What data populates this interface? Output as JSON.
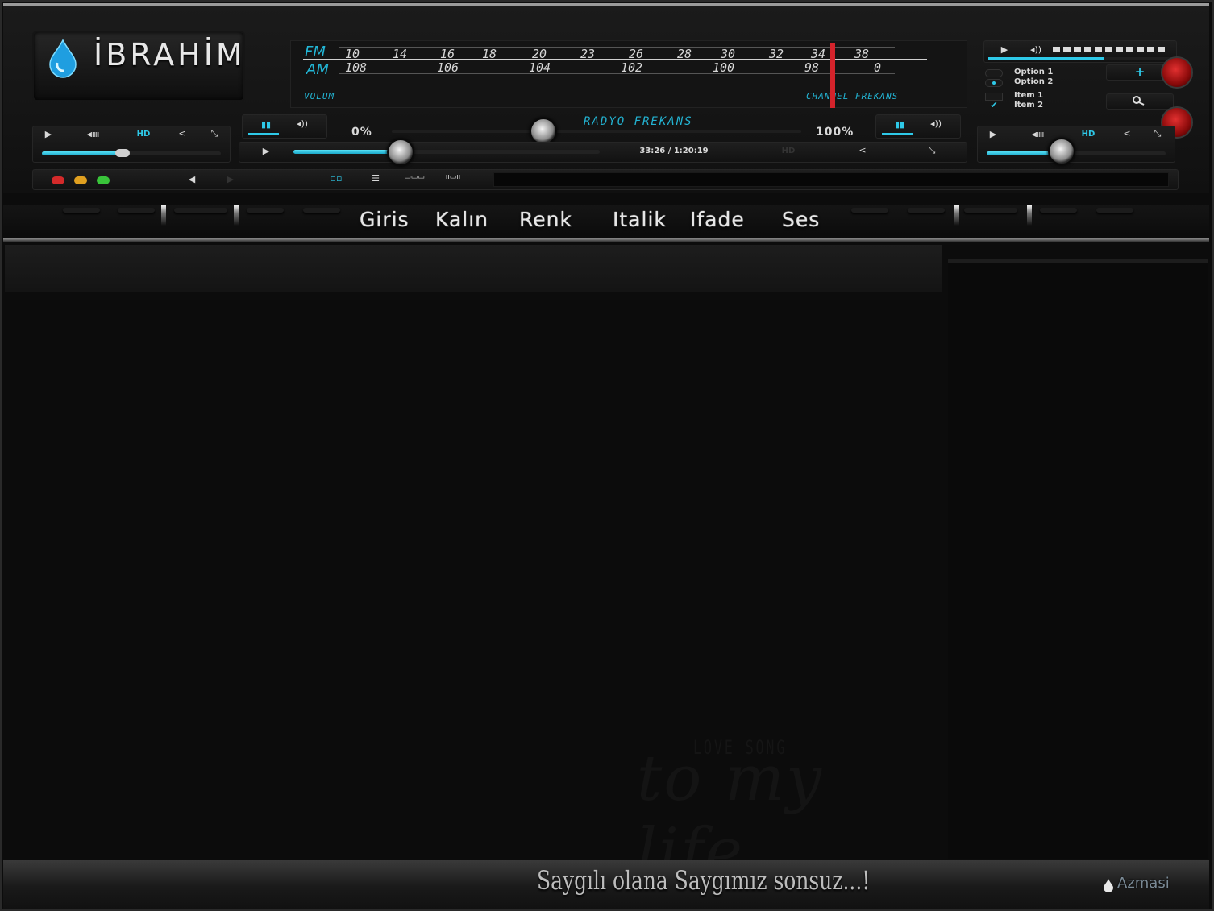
{
  "logo": {
    "text": "İBRAHİM",
    "icon": "water-drop-icon",
    "accent": "#2ec9e8"
  },
  "tuner": {
    "fm_label": "FM",
    "am_label": "AM",
    "fm_ticks": [
      "10",
      "14",
      "16",
      "18",
      "20",
      "23",
      "26",
      "28",
      "30",
      "32",
      "34",
      "38"
    ],
    "am_ticks": [
      "108",
      "106",
      "104",
      "102",
      "100",
      "98",
      "0"
    ],
    "volume_label": "VOLUM",
    "channel_label": "CHANNEL FREKANS",
    "needle_color": "#d4232b"
  },
  "radio": {
    "title": "RADYO FREKANS",
    "min_label": "0%",
    "max_label": "100%",
    "time": "33:26 / 1:20:19",
    "hd": "HD",
    "progress": 0.35,
    "volume_pos": 0.37
  },
  "left_player": {
    "hd": "HD",
    "progress": 0.45
  },
  "right_player": {
    "hd": "HD",
    "progress": 0.42
  },
  "options": {
    "radios": [
      "Option 1",
      "Option 2"
    ],
    "checks": [
      "Item 1",
      "Item 2"
    ],
    "checked": "Item 2",
    "selected": "Option 2",
    "level": 0.62
  },
  "window_dots": [
    "#d42a2a",
    "#e0a020",
    "#39c43a"
  ],
  "nav": {
    "items": [
      "Giris",
      "Kalın",
      "Renk",
      "Italik",
      "Ifade",
      "Ses"
    ]
  },
  "footer": {
    "motto": "Saygılı olana  Saygımız sonsuz...!",
    "brand": "Azmasi"
  },
  "watermark": {
    "line1": "LOVE SONG",
    "line2": "to my life"
  },
  "colors": {
    "accent": "#2ec9e8",
    "needle": "#d4232b",
    "background": "#0c0c0c"
  }
}
